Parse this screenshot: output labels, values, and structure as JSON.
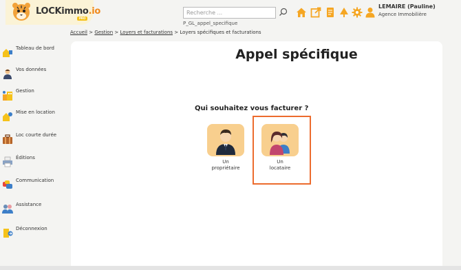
{
  "app": {
    "logo_main": "LOCKimmo",
    "logo_suffix": ".io",
    "logo_badge": "PRO"
  },
  "search": {
    "placeholder": "Recherche ...",
    "value": ""
  },
  "page_code": "P_GL_appel_specifique",
  "header_icons": [
    "home-icon",
    "edit-external-icon",
    "document-icon",
    "tree-icon",
    "gear-icon",
    "user-icon"
  ],
  "user": {
    "name": "LEMAIRE (Pauline)",
    "agency": "Agence Immobilière"
  },
  "breadcrumb": {
    "items": [
      "Accueil",
      "Gestion",
      "Loyers et facturations"
    ],
    "separator": ">",
    "current": "Loyers spécifiques et facturations"
  },
  "sidebar": {
    "items": [
      {
        "label": "Tableau de bord",
        "icon": "dashboard-icon"
      },
      {
        "label": "Vos données",
        "icon": "person-icon"
      },
      {
        "label": "Gestion",
        "icon": "buildings-icon"
      },
      {
        "label": "Mise en location",
        "icon": "key-house-icon"
      },
      {
        "label": "Loc courte durée",
        "icon": "suitcase-icon"
      },
      {
        "label": "Éditions",
        "icon": "printer-icon"
      },
      {
        "label": "Communication",
        "icon": "chat-icon"
      },
      {
        "label": "Assistance",
        "icon": "support-icon"
      },
      {
        "label": "Déconnexion",
        "icon": "logout-icon"
      }
    ]
  },
  "main": {
    "title": "Appel spécifique",
    "question": "Qui souhaitez vous facturer ?",
    "choices": [
      {
        "line1": "Un",
        "line2": "propriétaire",
        "icon": "owner-man-icon"
      },
      {
        "line1": "Un",
        "line2": "locataire",
        "icon": "tenant-people-icon"
      }
    ],
    "selected": "Un locataire"
  },
  "colors": {
    "accent_orange": "#f08a1c",
    "selection_border": "#ec6b2d",
    "tile": "#f8cf8e",
    "logo_bg": "#fbf3d6"
  }
}
